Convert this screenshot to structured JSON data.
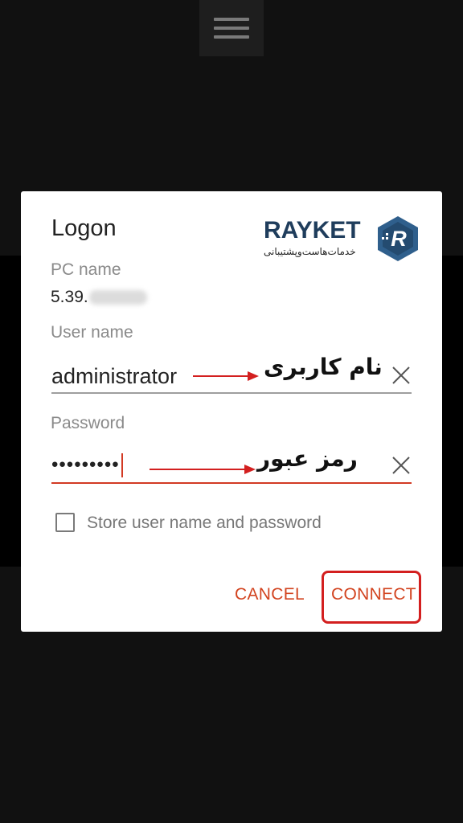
{
  "menu": {
    "icon": "hamburger-menu-icon"
  },
  "dialog": {
    "title": "Logon",
    "logo": {
      "text": "RAYKET",
      "subtitle": "خدمات‌هاست‌وپشتیبانی",
      "badge_letter": "R",
      "colors": {
        "primary": "#1f3d5c",
        "badge": "#2f5f8c"
      }
    },
    "pc_name": {
      "label": "PC name",
      "value": "5.39."
    },
    "user_name": {
      "label": "User name",
      "value": "administrator",
      "annotation": "نام کاربری"
    },
    "password": {
      "label": "Password",
      "value": "•••••••••",
      "annotation": "رمز عبور"
    },
    "store_credentials": {
      "label": "Store user name and password",
      "checked": false
    },
    "buttons": {
      "cancel": "CANCEL",
      "connect": "CONNECT"
    }
  },
  "colors": {
    "accent": "#d2431f",
    "annotation_red": "#d31f1f",
    "background": "#111111",
    "dialog_bg": "#ffffff"
  }
}
